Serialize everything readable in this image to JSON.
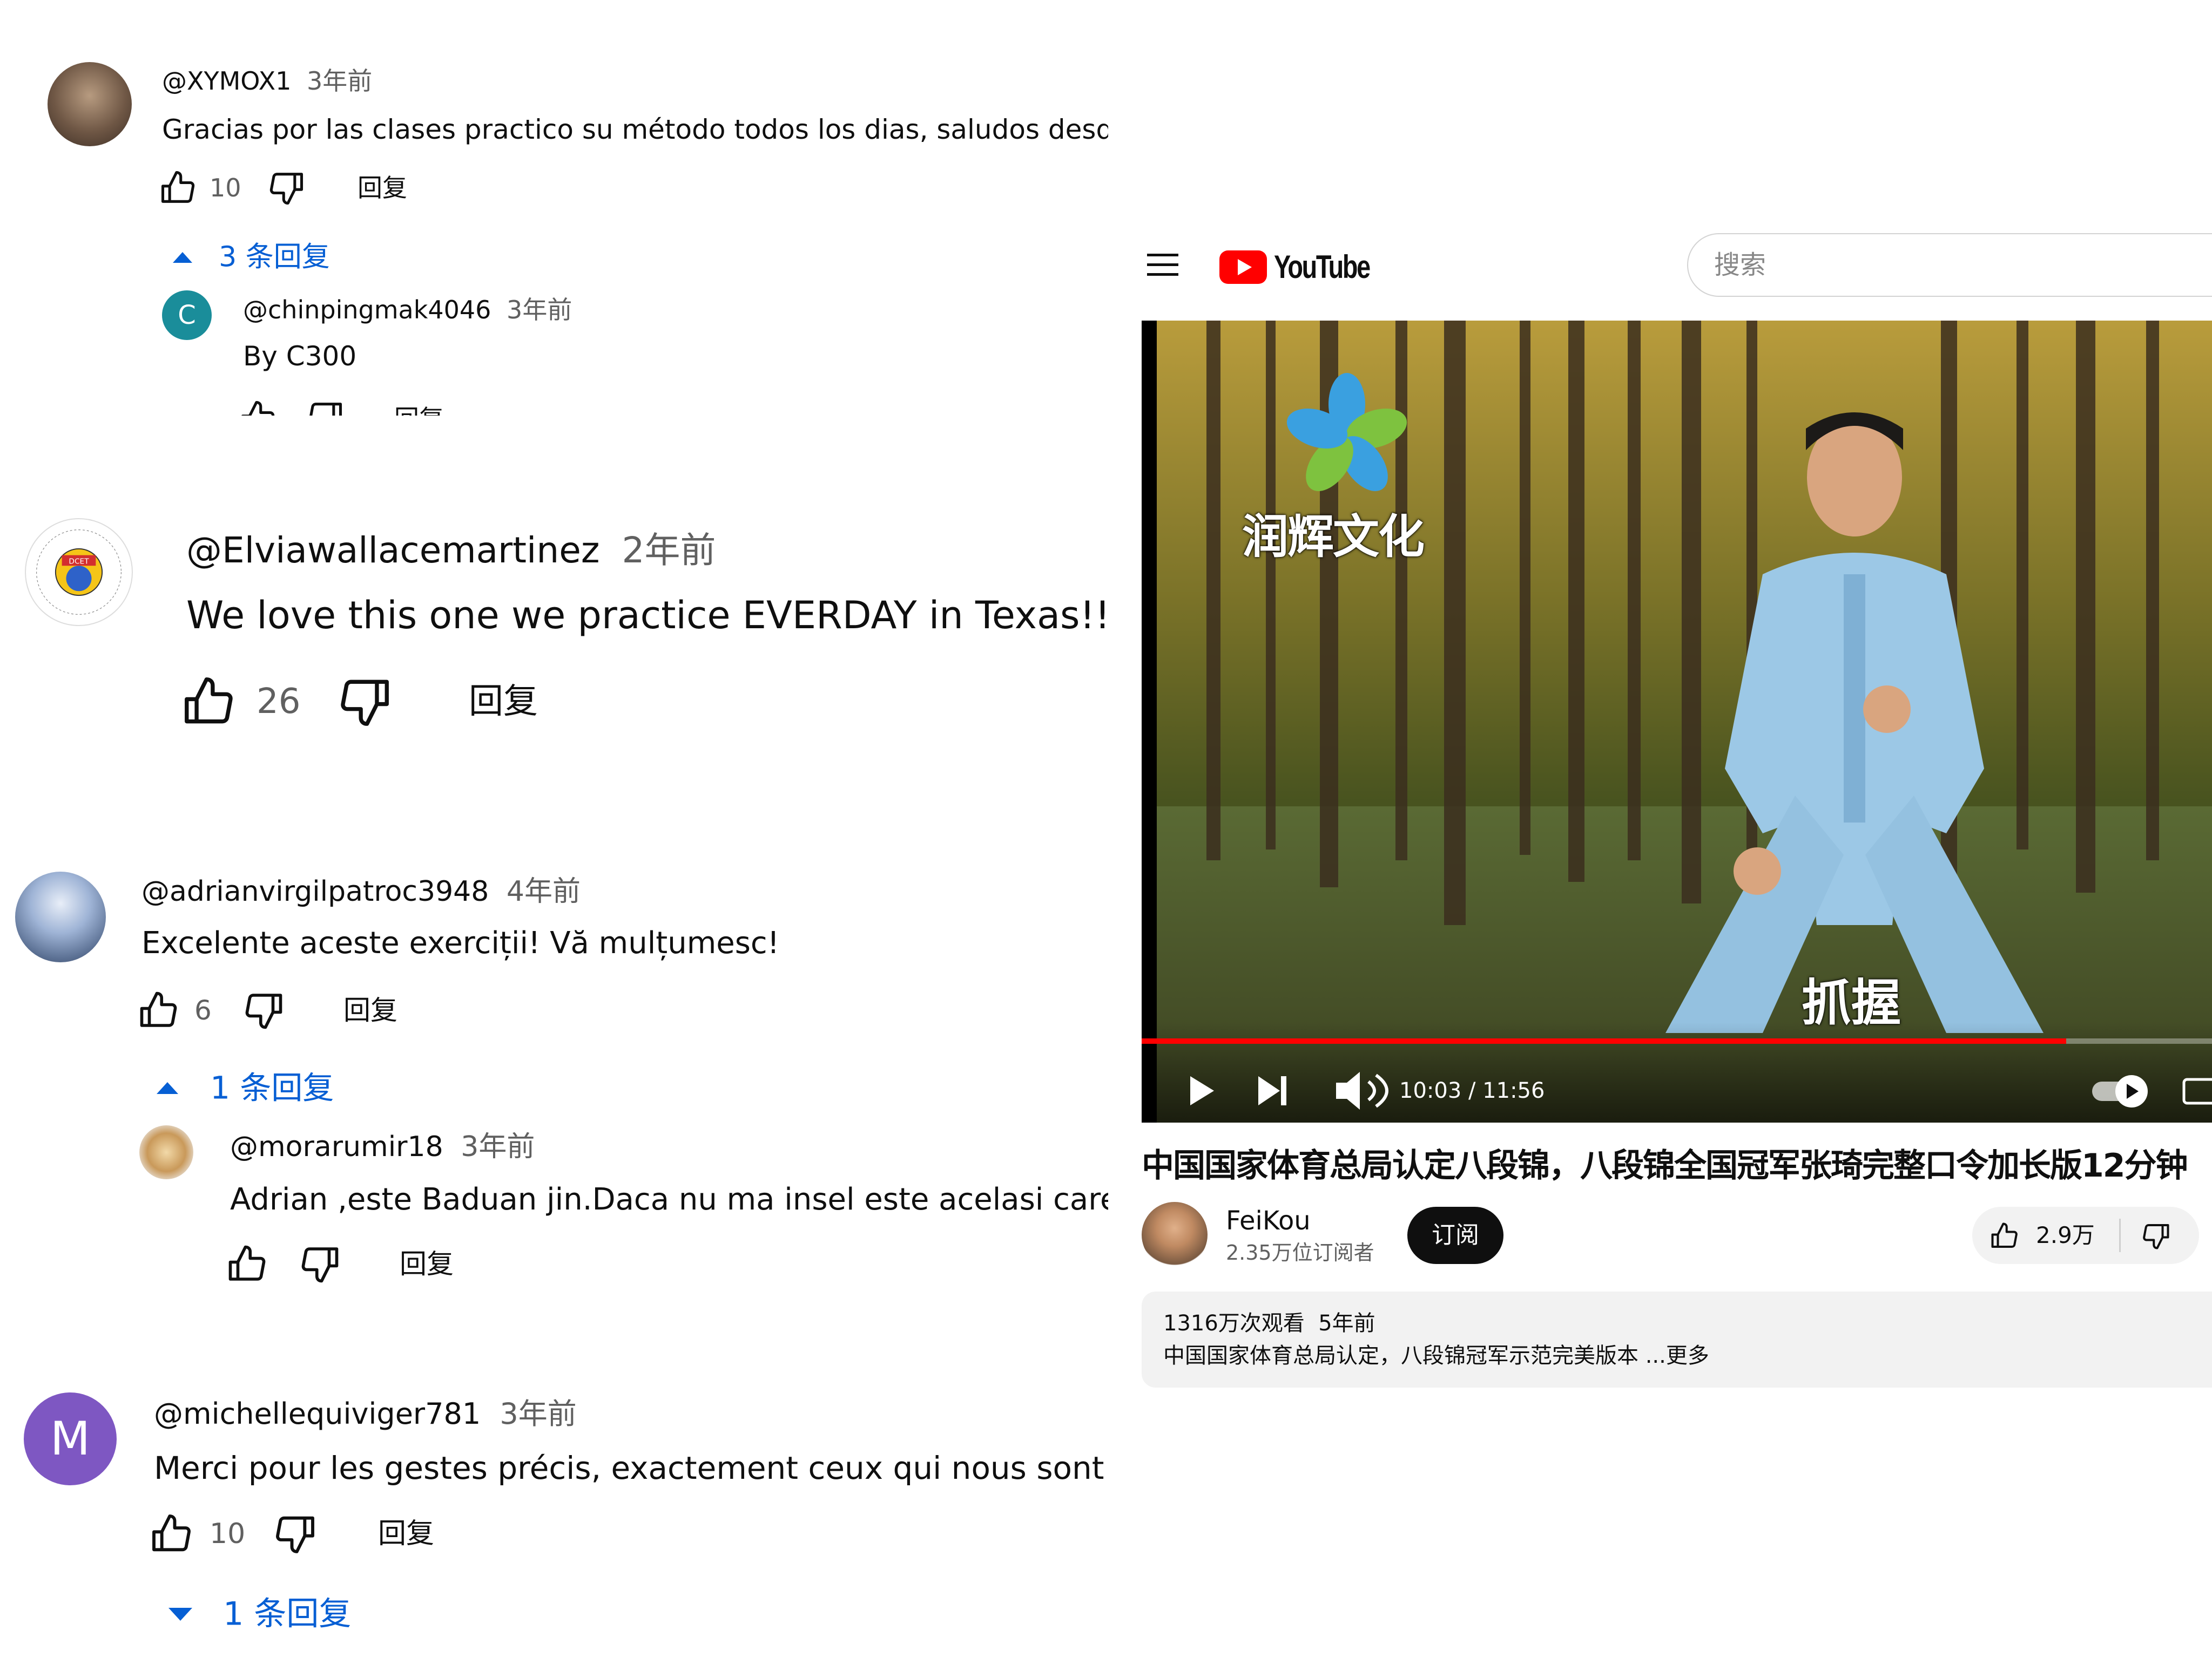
{
  "comments": [
    {
      "user": "@XYMOX1",
      "age": "3年前",
      "text": "Gracias por las clases practico su método todos los dias, saludos desde España",
      "likes": "10",
      "reply_label": "回复",
      "replies_toggle": "3 条回复",
      "reply": {
        "avatar_letter": "C",
        "user": "@chinpingmak4046",
        "age": "3年前",
        "text": "By C300",
        "reply_label": "回复"
      }
    },
    {
      "user": "@Elviawallacemartinez",
      "age": "2年前",
      "text": "We love this one we practice EVERDAY in Texas!!",
      "likes": "26",
      "reply_label": "回复",
      "avatar_badge": "DCET"
    },
    {
      "user": "@adrianvirgilpatroc3948",
      "age": "4年前",
      "text": "Excelente aceste exerciții! Vă mulțumesc!",
      "likes": "6",
      "reply_label": "回复",
      "replies_toggle": "1 条回复",
      "reply": {
        "user": "@morarumir18",
        "age": "3年前",
        "text": "Adrian ,este Baduan jin.Daca nu ma insel este acelasi care se in",
        "reply_label": "回复"
      }
    },
    {
      "avatar_letter": "M",
      "user": "@michellequiviger781",
      "age": "3年前",
      "text": "Merci pour les gestes précis, exactement ceux qui nous sont enseignés",
      "likes": "10",
      "reply_label": "回复",
      "replies_toggle": "1 条回复"
    }
  ],
  "youtube": {
    "logo_text": "YouTube",
    "search_placeholder": "搜索",
    "video": {
      "watermark": "润辉文化",
      "caption": "抓握",
      "time": "10:03 / 11:56",
      "progress": 0.864
    },
    "title": "中国国家体育总局认定八段锦，八段锦全国冠军张琦完整口令加长版12分钟",
    "channel": {
      "name": "FeiKou",
      "subscribers": "2.35万位订阅者",
      "subscribe_label": "订阅"
    },
    "likes": "2.9万",
    "description": {
      "meta": "1316万次观看  5年前",
      "text": "中国国家体育总局认定，八段锦冠军示范完美版本 ...更多"
    }
  },
  "colors": {
    "youtube_red": "#ff0000",
    "link_blue": "#065fd4",
    "avatar_teal": "#00838f",
    "avatar_purple": "#7e57c2"
  }
}
